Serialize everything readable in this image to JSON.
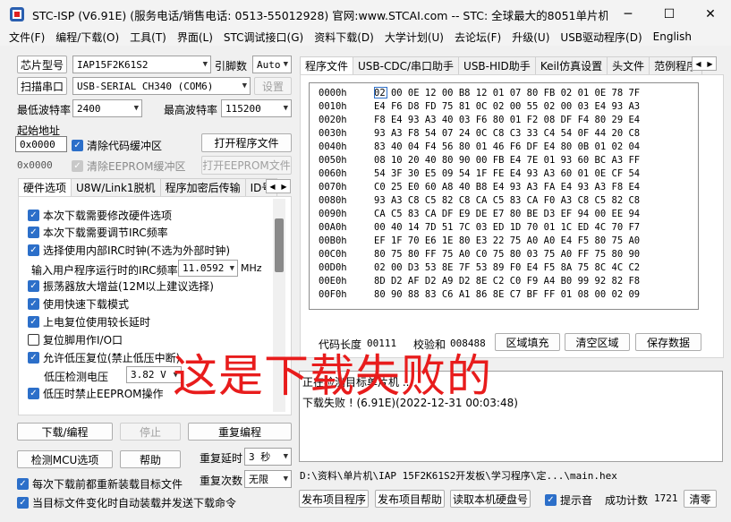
{
  "window": {
    "title": "STC-ISP (V6.91E) (服务电话/销售电话: 0513-55012928) 官网:www.STCAI.com  -- STC: 全球最大的8051单片机设...",
    "minimize": "─",
    "maximize": "☐",
    "close": "✕"
  },
  "menu": [
    "文件(F)",
    "编程/下载(O)",
    "工具(T)",
    "界面(L)",
    "STC调试接口(G)",
    "资料下载(D)",
    "大学计划(U)",
    "去论坛(F)",
    "升级(U)",
    "USB驱动程序(D)",
    "English"
  ],
  "left": {
    "chip_button": "芯片型号",
    "chip_value": "IAP15F2K61S2",
    "pin_label": "引脚数",
    "pin_value": "Auto",
    "scan_button": "扫描串口",
    "port_value": "USB-SERIAL CH340 (COM6)",
    "settings_button": "设置",
    "min_baud_label": "最低波特率",
    "min_baud_value": "2400",
    "max_baud_label": "最高波特率",
    "max_baud_value": "115200",
    "start_addr_label": "起始地址",
    "addr1": "0x0000",
    "clear_code": "清除代码缓冲区",
    "open_program": "打开程序文件",
    "addr2": "0x0000",
    "clear_eeprom": "清除EEPROM缓冲区",
    "open_eeprom": "打开EEPROM文件",
    "tabs": [
      "硬件选项",
      "U8W/Link1脱机",
      "程序加密后传输",
      "ID号"
    ],
    "options": [
      {
        "label": "本次下载需要修改硬件选项",
        "checked": true
      },
      {
        "label": "本次下载需要调节IRC频率",
        "checked": true
      },
      {
        "label": "选择使用内部IRC时钟(不选为外部时钟)",
        "checked": true
      }
    ],
    "irc_label": "输入用户程序运行时的IRC频率",
    "irc_value": "11.0592",
    "irc_unit": "MHz",
    "options2": [
      {
        "label": "振荡器放大增益(12M以上建议选择)",
        "checked": true
      },
      {
        "label": "使用快速下载模式",
        "checked": true
      },
      {
        "label": "上电复位使用较长延时",
        "checked": true
      },
      {
        "label": "复位脚用作I/O口",
        "checked": false
      },
      {
        "label": "允许低压复位(禁止低压中断)",
        "checked": true
      }
    ],
    "lvd_label": "低压检测电压",
    "lvd_value": "3.82 V",
    "option_last": {
      "label": "低压时禁止EEPROM操作",
      "checked": true
    },
    "download_button": "下载/编程",
    "stop_button": "停止",
    "reprogram_button": "重复编程",
    "check_mcu_button": "检测MCU选项",
    "help_button": "帮助",
    "repeat_delay_label": "重复延时",
    "repeat_delay_value": "3 秒",
    "repeat_count_label": "重复次数",
    "repeat_count_value": "无限",
    "reload_each": "每次下载前都重新装载目标文件",
    "auto_reload": "当目标文件变化时自动装载并发送下载命令"
  },
  "right": {
    "tabs": [
      "程序文件",
      "USB-CDC/串口助手",
      "USB-HID助手",
      "Keil仿真设置",
      "头文件",
      "范例程序"
    ],
    "hex_rows": [
      [
        "0000h",
        "02 00 0E 12 00 B8 12 01 07 80 FB 02 01 0E 78 7F"
      ],
      [
        "0010h",
        "E4 F6 D8 FD 75 81 0C 02 00 55 02 00 03 E4 93 A3"
      ],
      [
        "0020h",
        "F8 E4 93 A3 40 03 F6 80 01 F2 08 DF F4 80 29 E4"
      ],
      [
        "0030h",
        "93 A3 F8 54 07 24 0C C8 C3 33 C4 54 0F 44 20 C8"
      ],
      [
        "0040h",
        "83 40 04 F4 56 80 01 46 F6 DF E4 80 0B 01 02 04"
      ],
      [
        "0050h",
        "08 10 20 40 80 90 00 FB E4 7E 01 93 60 BC A3 FF"
      ],
      [
        "0060h",
        "54 3F 30 E5 09 54 1F FE E4 93 A3 60 01 0E CF 54"
      ],
      [
        "0070h",
        "C0 25 E0 60 A8 40 B8 E4 93 A3 FA E4 93 A3 F8 E4"
      ],
      [
        "0080h",
        "93 A3 C8 C5 82 C8 CA C5 83 CA F0 A3 C8 C5 82 C8"
      ],
      [
        "0090h",
        "CA C5 83 CA DF E9 DE E7 80 BE D3 EF 94 00 EE 94"
      ],
      [
        "00A0h",
        "00 40 14 7D 51 7C 03 ED 1D 70 01 1C ED 4C 70 F7"
      ],
      [
        "00B0h",
        "EF 1F 70 E6 1E 80 E3 22 75 A0 A0 E4 F5 80 75 A0"
      ],
      [
        "00C0h",
        "80 75 80 FF 75 A0 C0 75 80 03 75 A0 FF 75 80 90"
      ],
      [
        "00D0h",
        "02 00 D3 53 8E 7F 53 89 F0 E4 F5 8A 75 8C 4C C2"
      ],
      [
        "00E0h",
        "8D D2 AF D2 A9 D2 8E C2 C0 F9 A4 B0 99 92 82 F8"
      ],
      [
        "00F0h",
        "80 90 88 83 C6 A1 86 8E C7 BF FF 01 08 00 02 09"
      ]
    ],
    "code_length_label": "代码长度",
    "code_length_value": "00111",
    "checksum_label": "校验和",
    "checksum_value": "008488",
    "fill_button": "区域填充",
    "clear_button": "清空区域",
    "save_button": "保存数据",
    "log_lines": [
      "正在检测目标单片机 ...",
      "下载失败 ! (6.91E)(2022-12-31 00:03:48)"
    ],
    "path": "D:\\资料\\单片机\\IAP 15F2K61S2开发板\\学习程序\\定...\\main.hex",
    "publish_button": "发布项目程序",
    "publish_help_button": "发布项目帮助",
    "read_disk_button": "读取本机硬盘号",
    "beep_label": "提示音",
    "success_label": "成功计数",
    "success_value": "1721",
    "clear_count_button": "清零"
  },
  "overlay_text": "这是下载失败的",
  "colors": {
    "accent": "#2c6fc9",
    "overlay": "#e81c1c"
  }
}
